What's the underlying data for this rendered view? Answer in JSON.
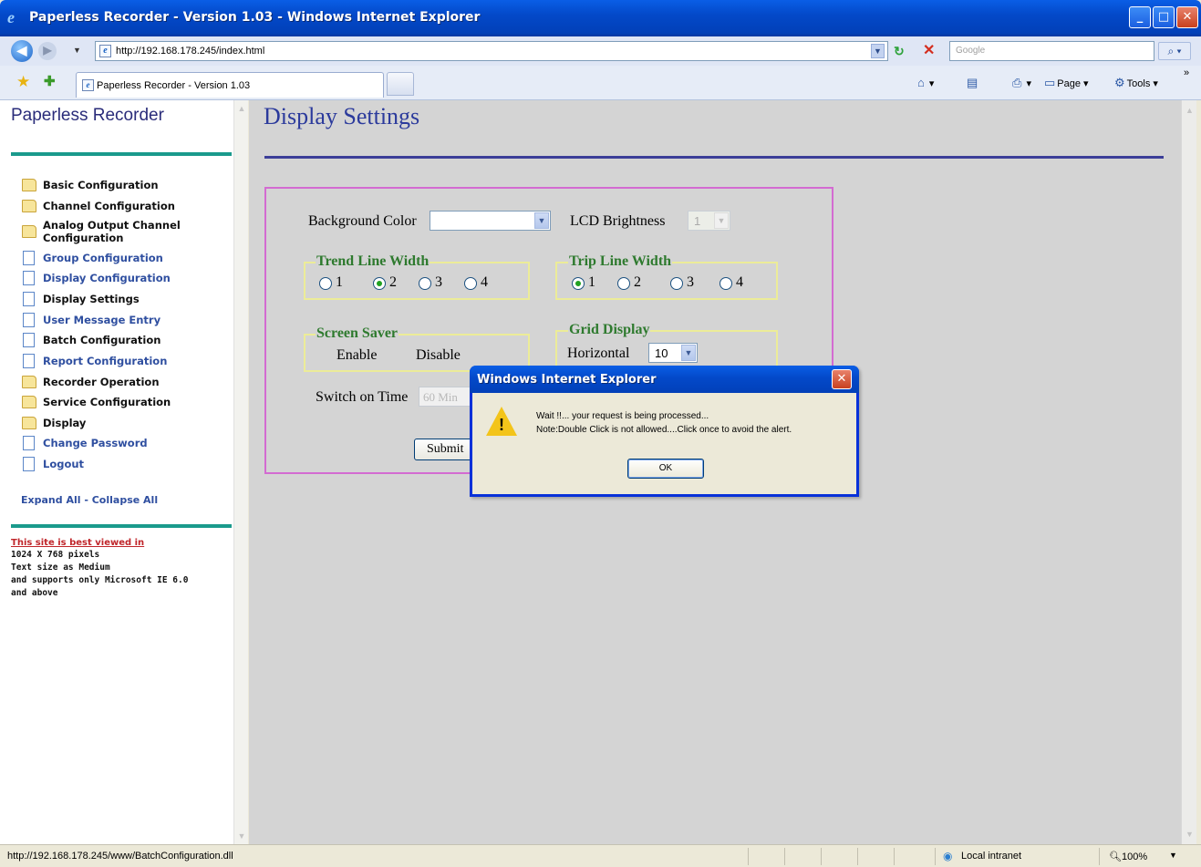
{
  "window": {
    "title": "Paperless Recorder - Version 1.03 - Windows Internet Explorer",
    "minimize": "_",
    "maximize": "□",
    "close": "✕"
  },
  "address_bar": {
    "url": "http://192.168.178.245/index.html",
    "search_placeholder": "Google"
  },
  "tab": {
    "label": "Paperless Recorder - Version 1.03"
  },
  "command_bar": {
    "items": [
      {
        "label": "",
        "icon": "home-icon"
      },
      {
        "label": "",
        "icon": "feeds-icon"
      },
      {
        "label": "",
        "icon": "print-icon"
      },
      {
        "label": "Page",
        "icon": "page-icon"
      },
      {
        "label": "Tools",
        "icon": "tools-icon"
      }
    ],
    "overflow": "»"
  },
  "sidebar": {
    "brand": "Paperless Recorder",
    "items": [
      {
        "label": "Basic Configuration",
        "type": "folder"
      },
      {
        "label": "Channel Configuration",
        "type": "folder"
      },
      {
        "label": "Analog Output Channel",
        "label2": "Configuration",
        "type": "folder"
      },
      {
        "label": "Group Configuration",
        "type": "page"
      },
      {
        "label": "Display Configuration",
        "type": "page"
      },
      {
        "label": "Display Settings",
        "type": "page"
      },
      {
        "label": "User Message Entry",
        "type": "page"
      },
      {
        "label": "Batch Configuration",
        "type": "page"
      },
      {
        "label": "Report Configuration",
        "type": "page"
      },
      {
        "label": "Recorder Operation",
        "type": "folder"
      },
      {
        "label": "Service Configuration",
        "type": "folder"
      },
      {
        "label": "Display",
        "type": "folder"
      },
      {
        "label": "Change Password",
        "type": "page"
      },
      {
        "label": "Logout",
        "type": "page"
      }
    ],
    "expand_all": "Expand All",
    "separator": " - ",
    "collapse_all": "Collapse All",
    "note_heading": "This site is best viewed in",
    "note_lines": [
      "1024 X 768 pixels",
      "Text size as Medium",
      "and supports only Microsoft IE 6.0",
      "and above"
    ]
  },
  "main": {
    "title": "Display Settings",
    "background_color_label": "Background Color",
    "background_color_value": "",
    "lcd_brightness_label": "LCD Brightness",
    "lcd_brightness_value": "1",
    "trend_line_width": {
      "legend": "Trend Line Width",
      "options": [
        "1",
        "2",
        "3",
        "4"
      ],
      "selected": "2"
    },
    "trip_line_width": {
      "legend": "Trip Line Width",
      "options": [
        "1",
        "2",
        "3",
        "4"
      ],
      "selected": "1"
    },
    "screen_saver": {
      "legend": "Screen Saver",
      "enable": "Enable",
      "disable": "Disable"
    },
    "grid_display": {
      "legend": "Grid Display",
      "horizontal_label": "Horizontal",
      "horizontal_value": "10"
    },
    "switch_on_time_label": "Switch on Time",
    "switch_on_time_value": "60 Min",
    "submit_label": "Submit"
  },
  "dialog": {
    "title": "Windows Internet Explorer",
    "line1": "Wait !!... your request is being processed...",
    "line2": "Note:Double Click is not allowed....Click once to avoid the alert.",
    "ok_label": "OK",
    "icon": "warning-icon"
  },
  "status_bar": {
    "text": "http://192.168.178.245/www/BatchConfiguration.dll",
    "zone": "Local intranet",
    "zoom": "100%"
  },
  "colors": {
    "title_blue": "#0349c9",
    "nav_accent": "#1a9a8c",
    "legend_green": "#2e7a2e",
    "box_border": "#d36bd1"
  }
}
